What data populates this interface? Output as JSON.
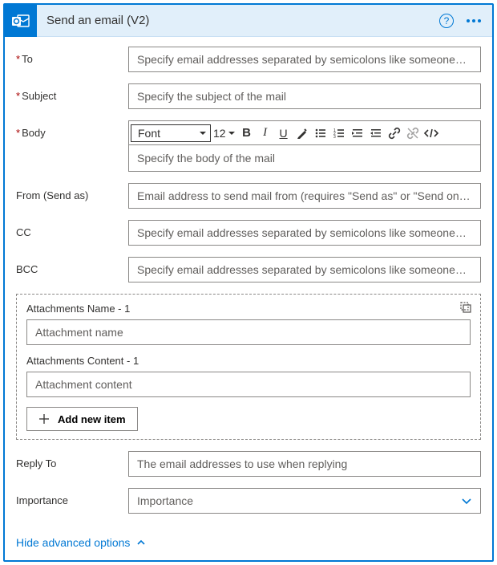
{
  "header": {
    "title": "Send an email (V2)"
  },
  "fields": {
    "to": {
      "label": "To",
      "required": true,
      "placeholder": "Specify email addresses separated by semicolons like someone@con"
    },
    "subject": {
      "label": "Subject",
      "required": true,
      "placeholder": "Specify the subject of the mail"
    },
    "body": {
      "label": "Body",
      "required": true,
      "placeholder": "Specify the body of the mail"
    },
    "from": {
      "label": "From (Send as)",
      "placeholder": "Email address to send mail from (requires \"Send as\" or \"Send on beh"
    },
    "cc": {
      "label": "CC",
      "placeholder": "Specify email addresses separated by semicolons like someone@con"
    },
    "bcc": {
      "label": "BCC",
      "placeholder": "Specify email addresses separated by semicolons like someone@con"
    },
    "reply_to": {
      "label": "Reply To",
      "placeholder": "The email addresses to use when replying"
    },
    "importance": {
      "label": "Importance",
      "placeholder": "Importance"
    }
  },
  "rte": {
    "font_label": "Font",
    "size_label": "12"
  },
  "attachments": {
    "name_label": "Attachments Name - 1",
    "name_placeholder": "Attachment name",
    "content_label": "Attachments Content - 1",
    "content_placeholder": "Attachment content",
    "add_label": "Add new item"
  },
  "footer": {
    "advanced_link": "Hide advanced options"
  }
}
